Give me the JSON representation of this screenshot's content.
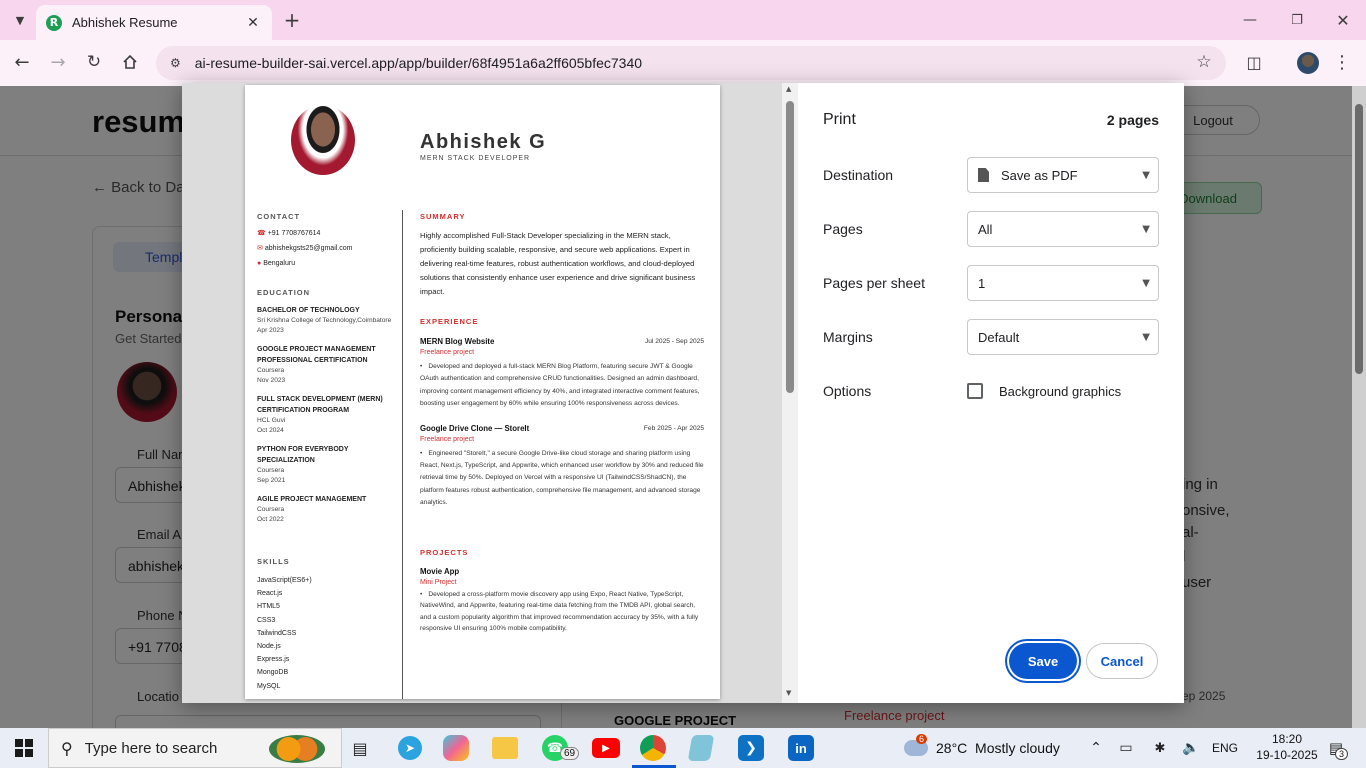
{
  "browser": {
    "tab_title": "Abhishek Resume",
    "tab_favicon_letter": "R",
    "url": "ai-resume-builder-sai.vercel.app/app/builder/68f4951a6a2ff605bfec7340"
  },
  "app_bg": {
    "logo": "resum",
    "logout": "Logout",
    "back": "Back to Da",
    "download": "Download",
    "templates": "Templ",
    "personal": "Personal",
    "get_started": "Get Started",
    "full_name_label": "Full Nar",
    "full_name_value": "Abhishek",
    "email_label": "Email A",
    "email_value": "abhishekg",
    "phone_label": "Phone N",
    "phone_value": "+91 77087",
    "location_label": "Locatio",
    "right_lines": [
      "ing in",
      "onsive,",
      "al-",
      "l",
      "user"
    ],
    "sep_2025": "ep 2025",
    "google_project": "GOOGLE PROJECT",
    "freelance": "Freelance project"
  },
  "resume": {
    "name": "Abhishek G",
    "title": "MERN STACK DEVELOPER",
    "contact_heading": "CONTACT",
    "phone": "+91 7708767614",
    "email": "abhishekgsts25@gmail.com",
    "location": "Bengaluru",
    "education_heading": "EDUCATION",
    "education": [
      {
        "degree": "BACHELOR OF TECHNOLOGY",
        "school": "Sri Krishna College of Technology,Coimbatore",
        "date": "Apr 2023"
      },
      {
        "degree": "GOOGLE PROJECT MANAGEMENT PROFESSIONAL CERTIFICATION",
        "school": "Coursera",
        "date": "Nov 2023"
      },
      {
        "degree": "FULL STACK DEVELOPMENT (MERN) CERTIFICATION PROGRAM",
        "school": "HCL Guvi",
        "date": "Oct 2024"
      },
      {
        "degree": "PYTHON FOR EVERYBODY SPECIALIZATION",
        "school": "Coursera",
        "date": "Sep 2021"
      },
      {
        "degree": "AGILE PROJECT MANAGEMENT",
        "school": "Coursera",
        "date": "Oct 2022"
      }
    ],
    "skills_heading": "SKILLS",
    "skills": [
      "JavaScript(ES6+)",
      "React.js",
      "HTML5",
      "CSS3",
      "TailwindCSS",
      "Node.js",
      "Express.js",
      "MongoDB",
      "MySQL"
    ],
    "summary_heading": "SUMMARY",
    "summary": "Highly accomplished Full-Stack Developer specializing in the MERN stack, proficiently building scalable, responsive, and secure web applications. Expert in delivering real-time features, robust authentication workflows, and cloud-deployed solutions that consistently enhance user experience and drive significant business impact.",
    "experience_heading": "EXPERIENCE",
    "experience": [
      {
        "title": "MERN Blog Website",
        "date": "Jul 2025 - Sep 2025",
        "type": "Freelance project",
        "desc": "Developed and deployed a full-stack MERN Blog Platform, featuring secure JWT & Google OAuth authentication and comprehensive CRUD functionalities. Designed an admin dashboard, improving content management efficiency by 40%, and integrated interactive comment features, boosting user engagement by 60% while ensuring 100% responsiveness across devices."
      },
      {
        "title": "Google Drive Clone — StoreIt",
        "date": "Feb 2025 - Apr 2025",
        "type": "Freelance project",
        "desc": "Engineered \"StoreIt,\" a secure Google Drive-like cloud storage and sharing platform using React, Next.js, TypeScript, and Appwrite, which enhanced user workflow by 30% and reduced file retrieval time by 50%. Deployed on Vercel with a responsive UI (TailwindCSS/ShadCN), the platform features robust authentication, comprehensive file management, and advanced storage analytics."
      }
    ],
    "projects_heading": "PROJECTS",
    "projects": [
      {
        "title": "Movie App",
        "type": "Mini Project",
        "desc": "Developed a cross-platform movie discovery app using Expo, React Native, TypeScript, NativeWind, and Appwrite, featuring real-time data fetching from the TMDB API, global search, and a custom popularity algorithm that improved recommendation accuracy by 35%, with a fully responsive UI ensuring 100% mobile compatibility."
      }
    ]
  },
  "print": {
    "title": "Print",
    "pages_count": "2 pages",
    "destination_label": "Destination",
    "destination_value": "Save as PDF",
    "pages_label": "Pages",
    "pages_value": "All",
    "pps_label": "Pages per sheet",
    "pps_value": "1",
    "margins_label": "Margins",
    "margins_value": "Default",
    "options_label": "Options",
    "bg_graphics": "Background graphics",
    "bg_graphics_checked": false,
    "save": "Save",
    "cancel": "Cancel"
  },
  "taskbar": {
    "search_placeholder": "Type here to search",
    "whatsapp_badge": "69",
    "weather_badge": "6",
    "weather": "28°C  Mostly cloudy",
    "lang": "ENG",
    "time": "18:20",
    "date": "19-10-2025",
    "notif_count": "3"
  },
  "colors": {
    "accent": "#0b57d0",
    "resume_red": "#d32f2f",
    "chrome_pink": "#f8d7ee"
  }
}
